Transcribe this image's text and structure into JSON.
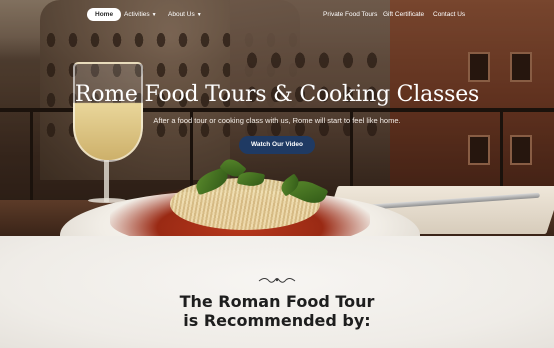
{
  "nav": {
    "home": "Home",
    "activities": "Activities",
    "about": "About Us",
    "private_tours": "Private Food Tours",
    "gift": "Gift Certificate",
    "contact": "Contact Us"
  },
  "hero": {
    "title": "Rome Food Tours & Cooking Classes",
    "subtitle": "After a food tour or cooking class with us, Rome will start to feel like home.",
    "button": "Watch Our Video"
  },
  "section": {
    "title_line1": "The Roman Food Tour",
    "title_line2": "is Recommended by:"
  },
  "colors": {
    "button_bg": "#1f3a63",
    "hero_text": "#ffffff",
    "section_title": "#1e1e1e"
  },
  "icons": {
    "dropdown": "chevron-down-icon",
    "ornament": "flourish-ornament-icon"
  }
}
